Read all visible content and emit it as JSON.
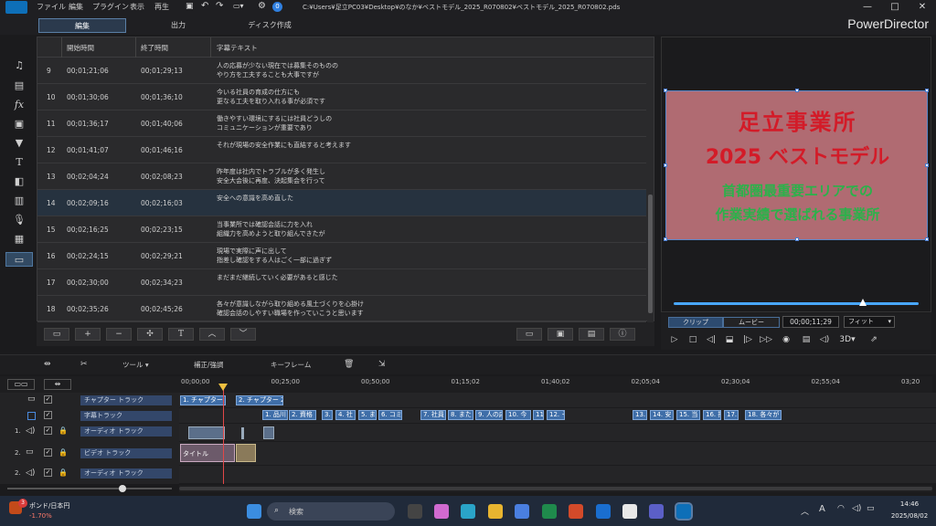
{
  "app": {
    "name": "PowerDirector",
    "file_path": "C:¥Users¥足立PC03¥Desktop¥のなか¥ベストモデル_2025_R070802¥ベストモデル_2025_R070802.pds",
    "menu": [
      "ファイル",
      "編集",
      "プラグイン",
      "表示",
      "再生"
    ],
    "window_controls": [
      "—",
      "□",
      "✕"
    ],
    "badge": "0"
  },
  "modes": [
    "編集",
    "出力",
    "ディスク作成"
  ],
  "subtitle_table": {
    "headers": [
      "開始時間",
      "終了時間",
      "字幕テキスト"
    ],
    "rows": [
      {
        "n": "9",
        "start": "00;01;21;06",
        "end": "00;01;29;13",
        "text": "人の応募が少ない現在では募集そのものの\nやり方を工夫することも大事ですが"
      },
      {
        "n": "10",
        "start": "00;01;30;06",
        "end": "00;01;36;10",
        "text": "今いる社員の育成の仕方にも\n更なる工夫を取り入れる事が必須です"
      },
      {
        "n": "11",
        "start": "00;01;36;17",
        "end": "00;01;40;06",
        "text": "働きやすい環境にするには社員どうしの\nコミュニケーションが重要であり"
      },
      {
        "n": "12",
        "start": "00;01;41;07",
        "end": "00;01;46;16",
        "text": "それが現場の安全作業にも直結すると考えます"
      },
      {
        "n": "13",
        "start": "00;02;04;24",
        "end": "00;02;08;23",
        "text": "昨年度は社内でトラブルが多く発生し\n安全大会後に再度、決起集会を行って"
      },
      {
        "n": "14",
        "start": "00;02;09;16",
        "end": "00;02;16;03",
        "text": "安全への意識を高め直した"
      },
      {
        "n": "15",
        "start": "00;02;16;25",
        "end": "00;02;23;15",
        "text": "当事業所では確認会話に力を入れ\n組織力を高めようと取り組んできたが"
      },
      {
        "n": "16",
        "start": "00;02;24;15",
        "end": "00;02;29;21",
        "text": "現場で実際に声に出して\n指差し確認をする人はごく一部に過ぎず"
      },
      {
        "n": "17",
        "start": "00;02;30;00",
        "end": "00;02;34;23",
        "text": "まだまだ継続していく必要があると感じた"
      },
      {
        "n": "18",
        "start": "00;02;35;26",
        "end": "00;02;45;26",
        "text": "各々が意識しながら取り組める風土づくりを心掛け\n確認会話のしやすい職場を作っていこうと思います"
      }
    ]
  },
  "preview": {
    "title_line1": "足立事業所",
    "title_line2": "2025 ベストモデル",
    "sub_line1": "首都圏最重要エリアでの",
    "sub_line2": "作業実績で選ばれる事業所",
    "tab_clip": "クリップ",
    "tab_movie": "ムービー",
    "timecode": "00;00;11;29",
    "fit": "フィット",
    "mode_3d": "3D"
  },
  "timeline_tools": {
    "tools": "ツール",
    "correction": "補正/強調",
    "keyframe": "キーフレーム"
  },
  "ruler": [
    "00;00;00",
    "00;25;00",
    "00;50;00",
    "01;15;02",
    "01;40;02",
    "02;05;04",
    "02;30;04",
    "02;55;04",
    "03;20"
  ],
  "tracks": {
    "chapter": "チャプター トラック",
    "subtitle": "字幕トラック",
    "audio1_num": "1.",
    "audio1": "オーディオ トラック",
    "video2_num": "2.",
    "video2": "ビデオ トラック",
    "audio2_num": "2.",
    "audio2": "オーディオ トラック",
    "chapter_clips": [
      "1. チャプター 1",
      "2. チャプター 2"
    ],
    "subtitle_clips": [
      "1. 品川",
      "2. 資格",
      "3.",
      "4. 社",
      "5. ま",
      "6. コミ",
      "7. 社員",
      "8. また",
      "9. 人の応",
      "10. 今",
      "11.",
      "12. そ",
      "13.",
      "14. 安",
      "15. 当",
      "16. 指",
      "17.",
      "18. 各々が"
    ],
    "video_clip_label": "タイトル"
  },
  "taskbar": {
    "widget_title": "ポンド/日本円",
    "widget_value": "-1.70%",
    "widget_badge": "3",
    "search": "検索",
    "ime": "A",
    "time": "14:46",
    "date": "2025/08/02"
  }
}
